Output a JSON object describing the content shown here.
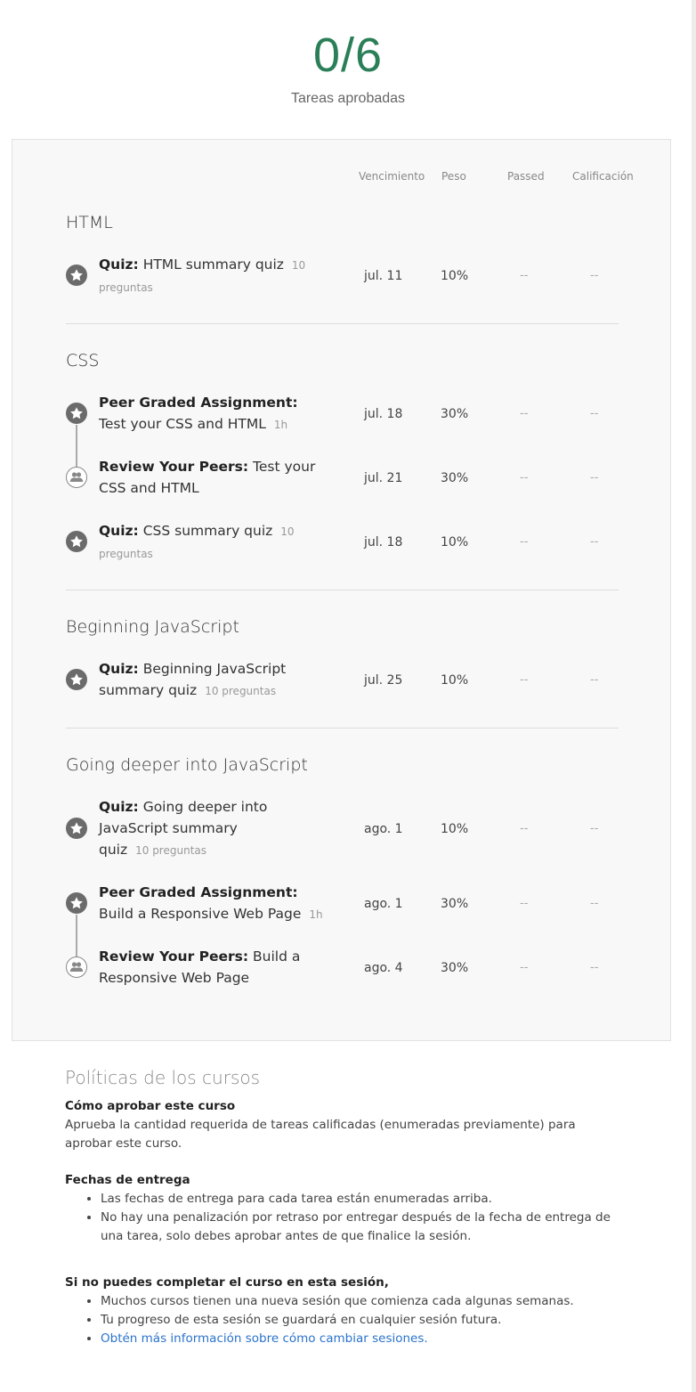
{
  "summary": {
    "count": "0/6",
    "label": "Tareas aprobadas"
  },
  "columns": {
    "due": "Vencimiento",
    "weight": "Peso",
    "passed": "Passed",
    "grade": "Calificación"
  },
  "sections": [
    {
      "title": "HTML"
    },
    {
      "title": "CSS"
    },
    {
      "title": "Beginning JavaScript"
    },
    {
      "title": "Going deeper into JavaScript"
    }
  ],
  "items": [
    {
      "type": "Quiz:",
      "name": "HTML summary quiz",
      "meta": "10 preguntas",
      "due": "jul. 11",
      "weight": "10%",
      "passed": "--",
      "grade": "--"
    },
    {
      "type": "Peer Graded Assignment:",
      "name": "Test your CSS and HTML",
      "meta": "1h",
      "due": "jul. 18",
      "weight": "30%",
      "passed": "--",
      "grade": "--"
    },
    {
      "type": "Review Your Peers:",
      "name": "Test your CSS and HTML",
      "meta": "",
      "due": "jul. 21",
      "weight": "30%",
      "passed": "--",
      "grade": "--"
    },
    {
      "type": "Quiz:",
      "name": "CSS summary quiz",
      "meta": "10 preguntas",
      "due": "jul. 18",
      "weight": "10%",
      "passed": "--",
      "grade": "--"
    },
    {
      "type": "Quiz:",
      "name": "Beginning JavaScript summary quiz",
      "meta": "10 preguntas",
      "due": "jul. 25",
      "weight": "10%",
      "passed": "--",
      "grade": "--"
    },
    {
      "type": "Quiz:",
      "name": "Going deeper into JavaScript summary quiz",
      "meta": "10 preguntas",
      "due": "ago. 1",
      "weight": "10%",
      "passed": "--",
      "grade": "--"
    },
    {
      "type": "Peer Graded Assignment:",
      "name": "Build a Responsive Web Page",
      "meta": "1h",
      "due": "ago. 1",
      "weight": "30%",
      "passed": "--",
      "grade": "--"
    },
    {
      "type": "Review Your Peers:",
      "name": "Build a Responsive Web Page",
      "meta": "",
      "due": "ago. 4",
      "weight": "30%",
      "passed": "--",
      "grade": "--"
    }
  ],
  "policies": {
    "title": "Políticas de los cursos",
    "pass_heading": "Cómo aprobar este curso",
    "pass_text": "Aprueba la cantidad requerida de tareas calificadas (enumeradas previamente) para aprobar este curso.",
    "due_heading": "Fechas de entrega",
    "due_bullets": [
      "Las fechas de entrega para cada tarea están enumeradas arriba.",
      "No hay una penalización por retraso por entregar después de la fecha de entrega de una tarea, solo debes aprobar antes de que finalice la sesión."
    ],
    "session_heading": "Si no puedes completar el curso en esta sesión,",
    "session_bullets": [
      "Muchos cursos tienen una nueva sesión que comienza cada algunas semanas.",
      "Tu progreso de esta sesión se guardará en cualquier sesión futura."
    ],
    "session_link": "Obtén más información sobre cómo cambiar sesiones."
  }
}
